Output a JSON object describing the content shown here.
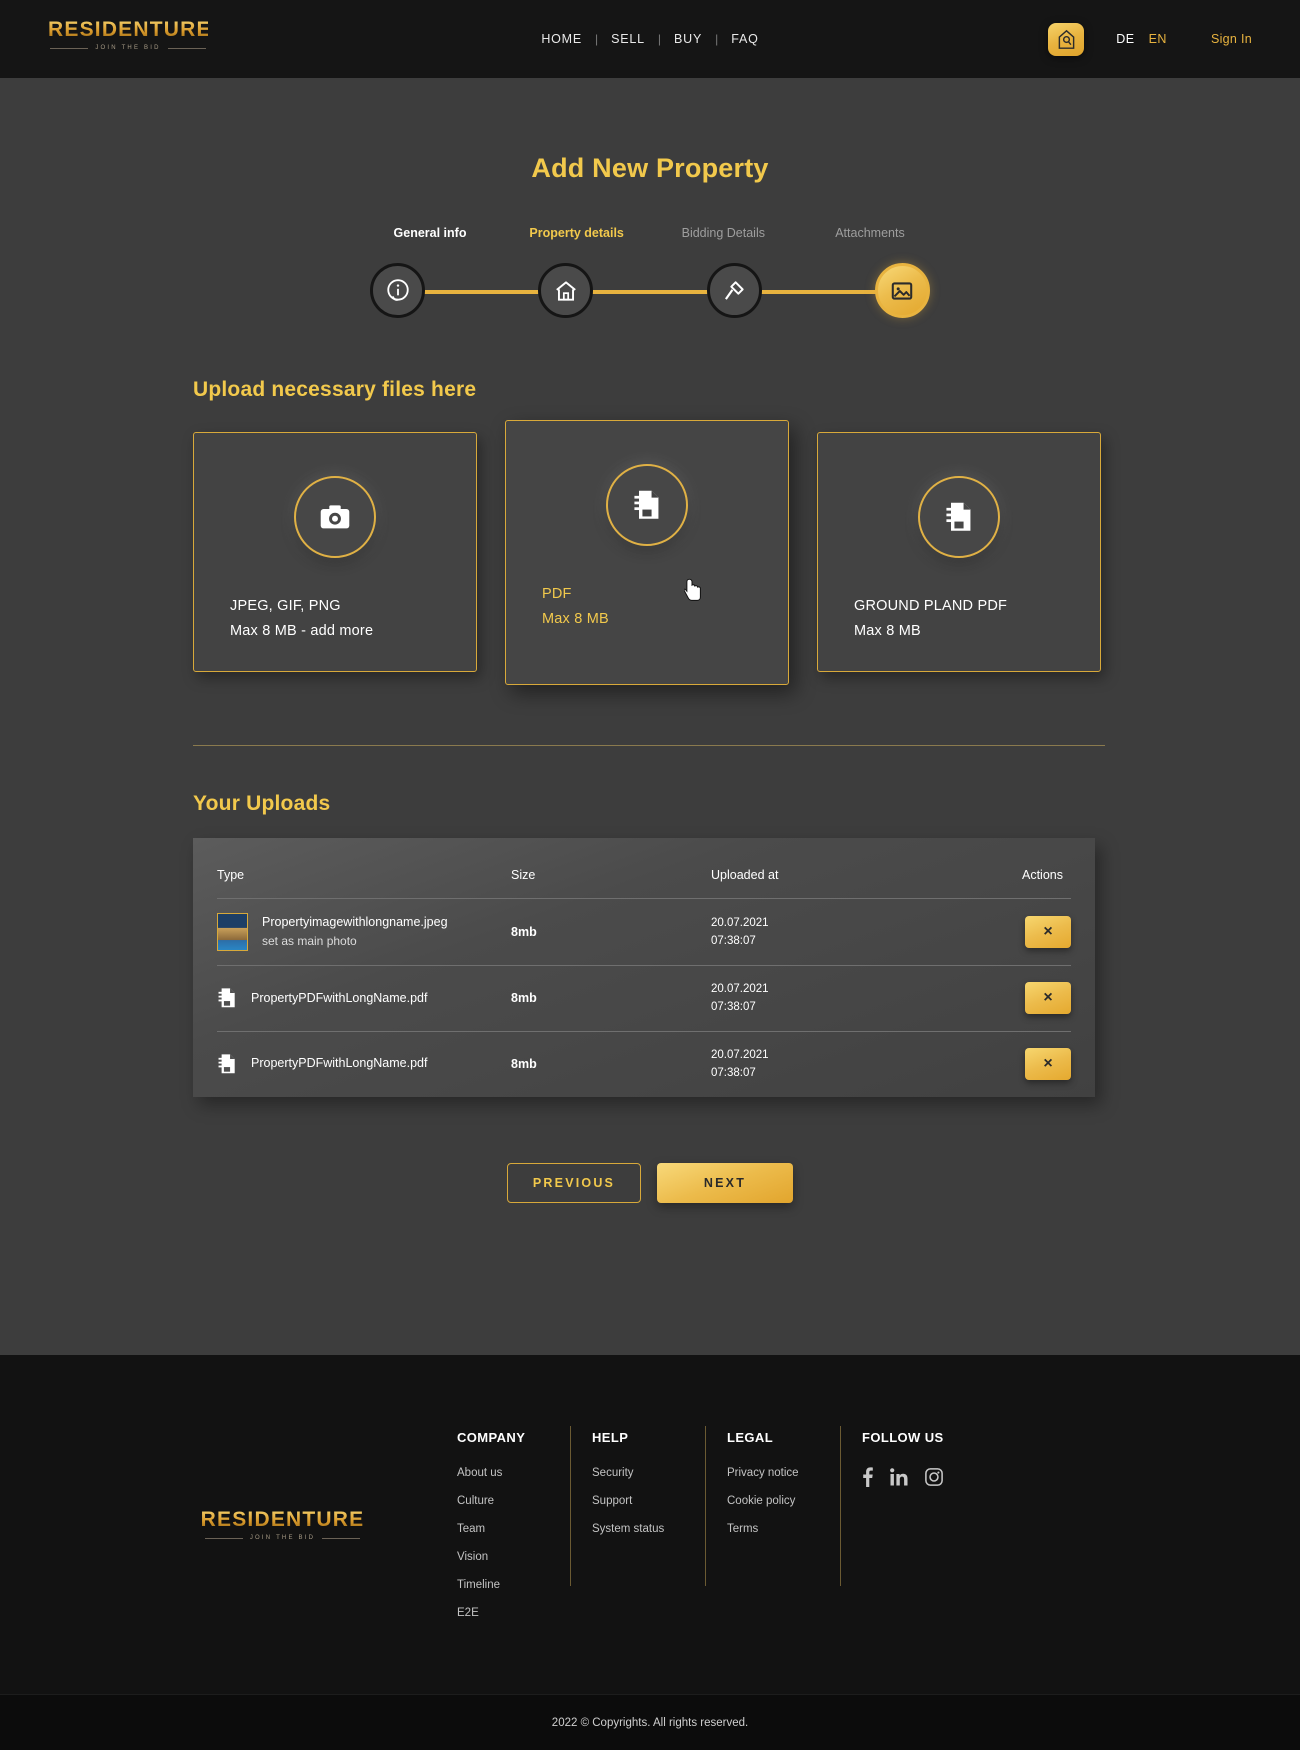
{
  "brand": {
    "name": "RESIDENTURE",
    "tagline": "JOIN THE BID"
  },
  "header": {
    "nav": [
      {
        "label": "HOME"
      },
      {
        "label": "SELL"
      },
      {
        "label": "BUY"
      },
      {
        "label": "FAQ"
      }
    ],
    "separator": "|",
    "home_icon": "house-badge-icon",
    "lang_de": "DE",
    "lang_en": "EN",
    "signin": "Sign In"
  },
  "main": {
    "title": "Add New Property",
    "stepper": [
      {
        "label": "General info",
        "state": "done",
        "icon": "info-circle-icon"
      },
      {
        "label": "Property details",
        "state": "active",
        "icon": "house-icon"
      },
      {
        "label": "Bidding Details",
        "state": "idle",
        "icon": "gavel-icon"
      },
      {
        "label": "Attachments",
        "state": "current",
        "icon": "image-icon"
      }
    ],
    "upload_section_title": "Upload necessary files here",
    "cards": [
      {
        "icon": "camera-icon",
        "line1": "JPEG, GIF, PNG",
        "line2": "Max 8 MB  - add more",
        "hover": false
      },
      {
        "icon": "document-icon",
        "line1": "PDF",
        "line2": "Max 8 MB",
        "hover": true
      },
      {
        "icon": "document-icon",
        "line1": "GROUND PLAND PDF",
        "line2": "Max 8 MB",
        "hover": false
      }
    ],
    "uploads_title": "Your Uploads",
    "table": {
      "columns": [
        "Type",
        "Size",
        "Uploaded at",
        "Actions"
      ],
      "rows": [
        {
          "icon": "image-thumbnail",
          "name": "Propertyimagewithlongname.jpeg",
          "sub": "set as main photo",
          "size": "8mb",
          "date": "20.07.2021",
          "time": "07:38:07",
          "action_icon": "close-icon",
          "action_label": "×"
        },
        {
          "icon": "pdf-file-icon",
          "name": "PropertyPDFwithLongName.pdf",
          "sub": "",
          "size": "8mb",
          "date": "20.07.2021",
          "time": "07:38:07",
          "action_icon": "close-icon",
          "action_label": "×"
        },
        {
          "icon": "pdf-file-icon",
          "name": "PropertyPDFwithLongName.pdf",
          "sub": "",
          "size": "8mb",
          "date": "20.07.2021",
          "time": "07:38:07",
          "action_icon": "close-icon",
          "action_label": "×"
        }
      ]
    },
    "buttons": {
      "previous": "PREVIOUS",
      "next": "NEXT"
    }
  },
  "footer": {
    "columns": [
      {
        "heading": "COMPANY",
        "links": [
          "About us",
          "Culture",
          "Team",
          "Vision",
          "Timeline",
          "E2E"
        ]
      },
      {
        "heading": "HELP",
        "links": [
          "Security",
          "Support",
          "System status"
        ]
      },
      {
        "heading": "LEGAL",
        "links": [
          "Privacy notice",
          "Cookie policy",
          "Terms"
        ]
      }
    ],
    "follow_heading": "FOLLOW US",
    "socials": [
      "facebook-icon",
      "linkedin-icon",
      "instagram-icon"
    ],
    "copyright": "2022 © Copyrights. All rights reserved."
  },
  "colors": {
    "gold": "#e8b33f",
    "gold_light": "#f2c94c",
    "bg": "#3d3d3d",
    "header_bg": "#151515",
    "footer_bg": "#121212"
  }
}
